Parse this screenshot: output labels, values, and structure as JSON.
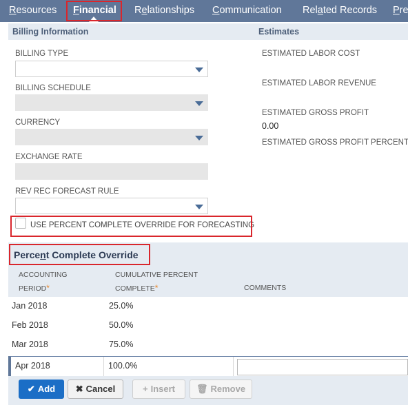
{
  "tabs": [
    {
      "label": "Resources",
      "access_key": "R",
      "rest": "esources"
    },
    {
      "label": "Financial",
      "access_key": "F",
      "rest": "inancial"
    },
    {
      "label": "Relationships",
      "pre": "R",
      "access_key": "e",
      "rest": "lationships"
    },
    {
      "label": "Communication",
      "access_key": "C",
      "rest": "ommunication"
    },
    {
      "label": "Related Records",
      "pre": "Rel",
      "access_key": "a",
      "rest": "ted Records"
    },
    {
      "label": "Pre",
      "access_key": "P",
      "rest": "re"
    }
  ],
  "active_tab": "Financial",
  "billing": {
    "section_title": "Billing Information",
    "billing_type_label": "BILLING TYPE",
    "billing_schedule_label": "BILLING SCHEDULE",
    "currency_label": "CURRENCY",
    "exchange_rate_label": "EXCHANGE RATE",
    "rev_rec_label": "REV REC FORECAST RULE",
    "checkbox_label": "USE PERCENT COMPLETE OVERRIDE FOR FORECASTING",
    "checkbox_checked": false
  },
  "estimates": {
    "section_title": "Estimates",
    "labor_cost_label": "ESTIMATED LABOR COST",
    "labor_revenue_label": "ESTIMATED LABOR REVENUE",
    "gross_profit_label": "ESTIMATED GROSS PROFIT",
    "gross_profit_value": "0.00",
    "gross_profit_percent_label": "ESTIMATED GROSS PROFIT PERCENT"
  },
  "sublist": {
    "title_pre": "Perce",
    "title_key": "n",
    "title_rest": "t Complete Override",
    "columns": {
      "period_line1": "ACCOUNTING",
      "period_line2": "PERIOD",
      "percent_line1": "CUMULATIVE PERCENT",
      "percent_line2": "COMPLETE",
      "comments": "COMMENTS",
      "mandatory_mark": "*"
    },
    "rows": [
      {
        "period": "Jan 2018",
        "percent": "25.0%"
      },
      {
        "period": "Feb 2018",
        "percent": "50.0%"
      },
      {
        "period": "Mar 2018",
        "percent": "75.0%"
      }
    ],
    "edit_row": {
      "period": "Apr 2018",
      "percent": "100.0%",
      "comments": ""
    },
    "buttons": {
      "add": "Add",
      "cancel": "Cancel",
      "insert": "Insert",
      "remove": "Remove"
    }
  },
  "colors": {
    "tab_bar": "#607799",
    "highlight_box": "#d9262c",
    "primary_button": "#1b6ec6",
    "section_bg": "#e5ebf2",
    "mandatory": "#e7862b"
  }
}
